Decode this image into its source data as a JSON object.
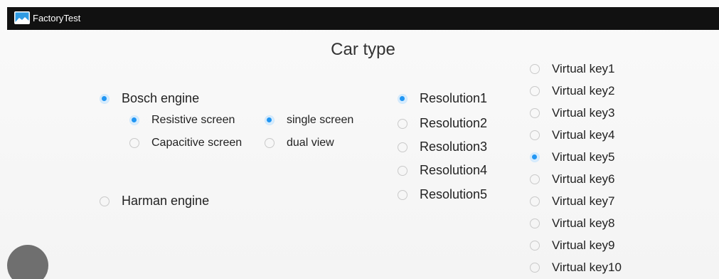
{
  "window": {
    "title": "FactoryTest"
  },
  "page": {
    "title": "Car type"
  },
  "engine_options": [
    {
      "label": "Bosch engine",
      "checked": true
    },
    {
      "label": "Harman engine",
      "checked": false
    }
  ],
  "screen_types": [
    {
      "label": "Resistive screen",
      "checked": true
    },
    {
      "label": "Capacitive screen",
      "checked": false
    }
  ],
  "view_modes": [
    {
      "label": "single screen",
      "checked": true
    },
    {
      "label": "dual view",
      "checked": false
    }
  ],
  "resolutions": [
    {
      "label": "Resolution1",
      "checked": true
    },
    {
      "label": "Resolution2",
      "checked": false
    },
    {
      "label": "Resolution3",
      "checked": false
    },
    {
      "label": "Resolution4",
      "checked": false
    },
    {
      "label": "Resolution5",
      "checked": false
    }
  ],
  "virtual_keys": [
    {
      "label": "Virtual key1",
      "checked": false
    },
    {
      "label": "Virtual key2",
      "checked": false
    },
    {
      "label": "Virtual key3",
      "checked": false
    },
    {
      "label": "Virtual key4",
      "checked": false
    },
    {
      "label": "Virtual key5",
      "checked": true
    },
    {
      "label": "Virtual key6",
      "checked": false
    },
    {
      "label": "Virtual key7",
      "checked": false
    },
    {
      "label": "Virtual key8",
      "checked": false
    },
    {
      "label": "Virtual key9",
      "checked": false
    },
    {
      "label": "Virtual key10",
      "checked": false
    }
  ],
  "icons": {
    "app": "image-icon",
    "checked_radio": "radio-checked-icon",
    "unchecked_radio": "radio-unchecked-icon",
    "floating": "floating-button-icon"
  },
  "colors": {
    "titlebar": "#111111",
    "accent": "#2196f3",
    "background": "#f7f7f7"
  }
}
